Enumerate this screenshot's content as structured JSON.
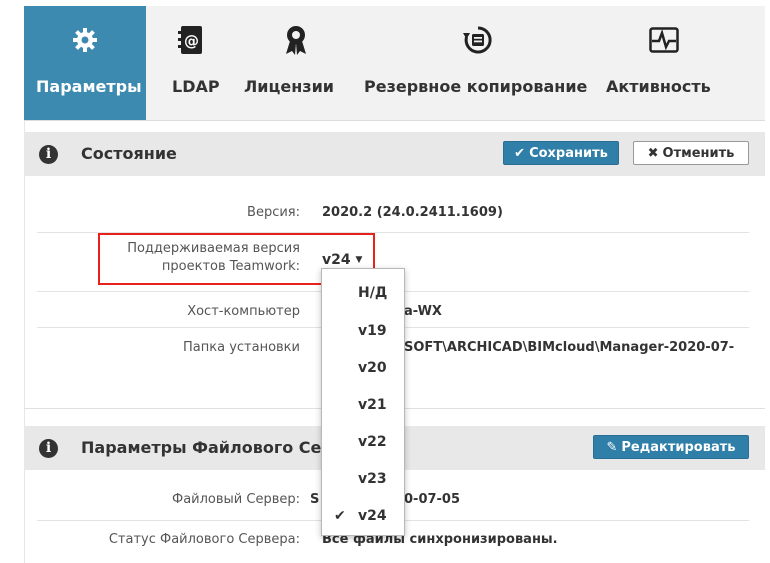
{
  "tabs": [
    {
      "label": "Параметры",
      "icon": "gear-icon",
      "active": true
    },
    {
      "label": "LDAP",
      "icon": "address-book-icon",
      "active": false
    },
    {
      "label": "Лицензии",
      "icon": "award-ribbon-icon",
      "active": false
    },
    {
      "label": "Резервное копирование",
      "icon": "backup-restore-icon",
      "active": false
    },
    {
      "label": "Активность",
      "icon": "activity-pulse-icon",
      "active": false
    }
  ],
  "status_section": {
    "title": "Состояние",
    "save_label": "Сохранить",
    "cancel_label": "Отменить",
    "rows": {
      "version_label": "Версия:",
      "version_value": "2020.2 (24.0.2411.1609)",
      "supported_label_line1": "Поддерживаемая версия",
      "supported_label_line2": "проектов Teamwork:",
      "supported_value": "v24",
      "host_label": "Хост-компьютер",
      "host_value_partial": "a-WX",
      "install_label": "Папка установки",
      "install_value_partial": "SOFT\\ARCHICAD\\BIMcloud\\Manager-2020-07-"
    }
  },
  "version_dropdown": {
    "options": [
      "Н/Д",
      "v19",
      "v20",
      "v21",
      "v22",
      "v23",
      "v24"
    ],
    "selected": "v24"
  },
  "file_server_section": {
    "title_partial": "Параметры Файлового Се",
    "edit_label": "Редактировать",
    "rows": {
      "server_label": "Файловый Сервер:",
      "server_value_partial": "0-07-05",
      "server_value_prefix": "S",
      "status_label": "Статус Файлового Сервера:",
      "status_value": "Все файлы синхронизированы."
    }
  },
  "colors": {
    "active_tab": "#3d8ab0",
    "primary_button": "#2f7fa8",
    "highlight_box": "#e8211d"
  }
}
